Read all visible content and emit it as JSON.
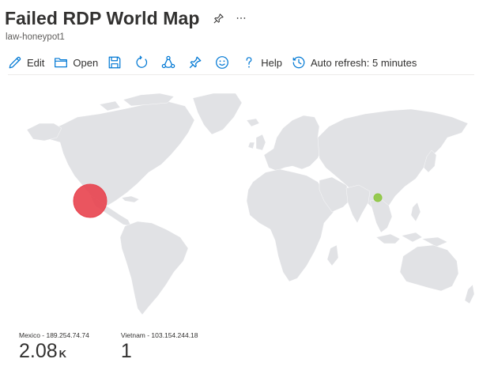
{
  "header": {
    "title": "Failed RDP World Map",
    "subtitle": "law-honeypot1"
  },
  "toolbar": {
    "edit_label": "Edit",
    "open_label": "Open",
    "help_label": "Help",
    "auto_refresh_label": "Auto refresh: 5 minutes"
  },
  "icons": {
    "pin": "pin-icon",
    "more": "more-icon",
    "edit": "pencil-icon",
    "open": "folder-icon",
    "save": "save-icon",
    "refresh": "refresh-icon",
    "share": "share-icon",
    "pin_dashboard": "pin-icon",
    "feedback": "smiley-icon",
    "help": "question-icon",
    "auto_refresh": "history-clock-icon"
  },
  "colors": {
    "accent": "#0078d4",
    "land": "#e1e2e5",
    "mexico_bubble": "#e8434e",
    "vietnam_bubble": "#8dc63f"
  },
  "map": {
    "points": [
      {
        "country": "Mexico",
        "ip": "189.254.74.74",
        "label": "Mexico - 189.254.74.74",
        "value": 2080,
        "display_value": "2.08",
        "display_unit": "K",
        "color": "#e8434e"
      },
      {
        "country": "Vietnam",
        "ip": "103.154.244.18",
        "label": "Vietnam - 103.154.244.18",
        "value": 1,
        "display_value": "1",
        "display_unit": "",
        "color": "#8dc63f"
      }
    ]
  }
}
